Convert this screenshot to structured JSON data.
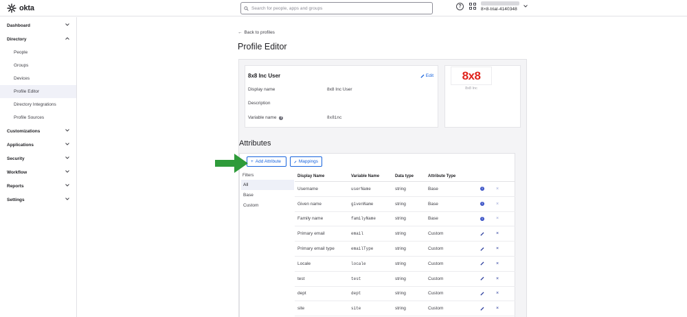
{
  "brand": {
    "name": "okta"
  },
  "search": {
    "placeholder": "Search for people, apps and groups"
  },
  "user": {
    "org": "8×8-trial-4140348"
  },
  "sidebar": {
    "groups": [
      {
        "label": "Dashboard"
      },
      {
        "label": "Directory"
      },
      {
        "label": "Customizations"
      },
      {
        "label": "Applications"
      },
      {
        "label": "Security"
      },
      {
        "label": "Workflow"
      },
      {
        "label": "Reports"
      },
      {
        "label": "Settings"
      }
    ],
    "directory_items": [
      {
        "label": "People"
      },
      {
        "label": "Groups"
      },
      {
        "label": "Devices"
      },
      {
        "label": "Profile Editor"
      },
      {
        "label": "Directory Integrations"
      },
      {
        "label": "Profile Sources"
      }
    ]
  },
  "main": {
    "back_label": "Back to profiles",
    "title": "Profile Editor",
    "profile": {
      "name": "8x8 Inc User",
      "edit_label": "Edit",
      "fields": [
        {
          "label": "Display name",
          "value": "8x8 Inc User"
        },
        {
          "label": "Description",
          "value": ""
        },
        {
          "label": "Variable name",
          "value": "8x8inc"
        }
      ],
      "logo_text": "8x8",
      "logo_caption": "8x8 Inc"
    },
    "attributes": {
      "title": "Attributes",
      "add_label": "Add Attribute",
      "mappings_label": "Mappings",
      "filters_label": "Filters",
      "filters": [
        "All",
        "Base",
        "Custom"
      ],
      "columns": [
        "Display Name",
        "Variable Name",
        "Data type",
        "Attribute Type"
      ],
      "rows": [
        {
          "display": "Username",
          "variable": "userName",
          "type": "string",
          "attr": "Base"
        },
        {
          "display": "Given name",
          "variable": "givenName",
          "type": "string",
          "attr": "Base"
        },
        {
          "display": "Family name",
          "variable": "familyName",
          "type": "string",
          "attr": "Base"
        },
        {
          "display": "Primary email",
          "variable": "email",
          "type": "string",
          "attr": "Custom"
        },
        {
          "display": "Primary email type",
          "variable": "emailType",
          "type": "string",
          "attr": "Custom"
        },
        {
          "display": "Locale",
          "variable": "locale",
          "type": "string",
          "attr": "Custom"
        },
        {
          "display": "test",
          "variable": "test",
          "type": "string",
          "attr": "Custom"
        },
        {
          "display": "dept",
          "variable": "dept",
          "type": "string",
          "attr": "Custom"
        },
        {
          "display": "site",
          "variable": "site",
          "type": "string",
          "attr": "Custom"
        }
      ]
    }
  },
  "colors": {
    "link": "#1662dd",
    "annotation_arrow": "#2e9b3a",
    "logo_red": "#e0231c"
  }
}
